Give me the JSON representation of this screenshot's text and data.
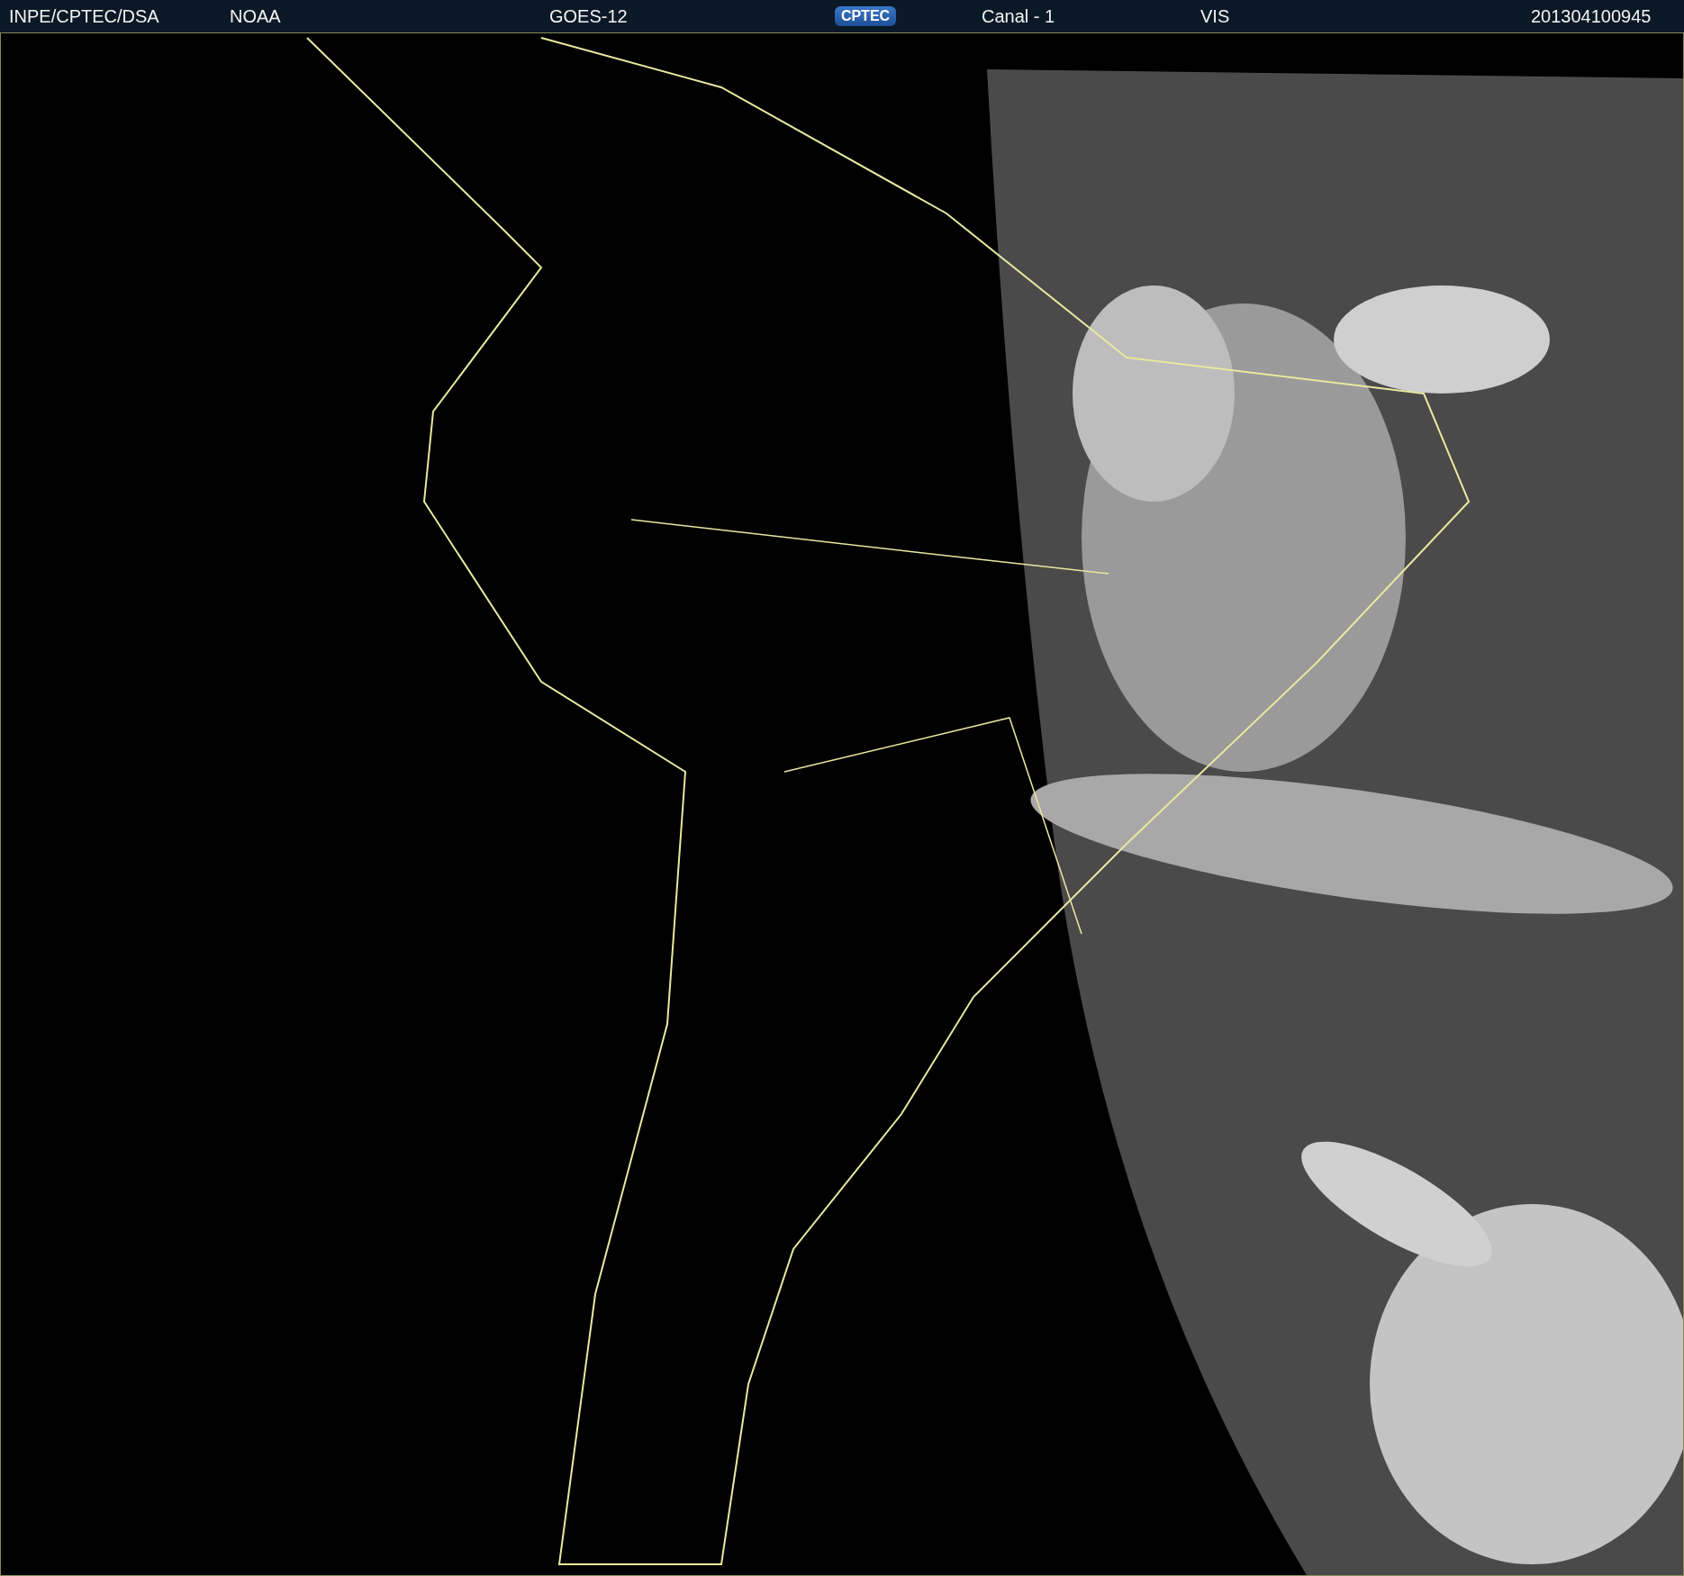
{
  "header": {
    "items": [
      {
        "kind": "text",
        "text": "INPE/CPTEC/DSA"
      },
      {
        "kind": "text",
        "text": "NOAA"
      },
      {
        "kind": "text",
        "text": "GOES-12"
      },
      {
        "kind": "logo",
        "text": "CPTEC"
      },
      {
        "kind": "text",
        "text": "Canal - 1"
      },
      {
        "kind": "text",
        "text": "VIS"
      },
      {
        "kind": "text",
        "text": "201304100945"
      }
    ]
  }
}
